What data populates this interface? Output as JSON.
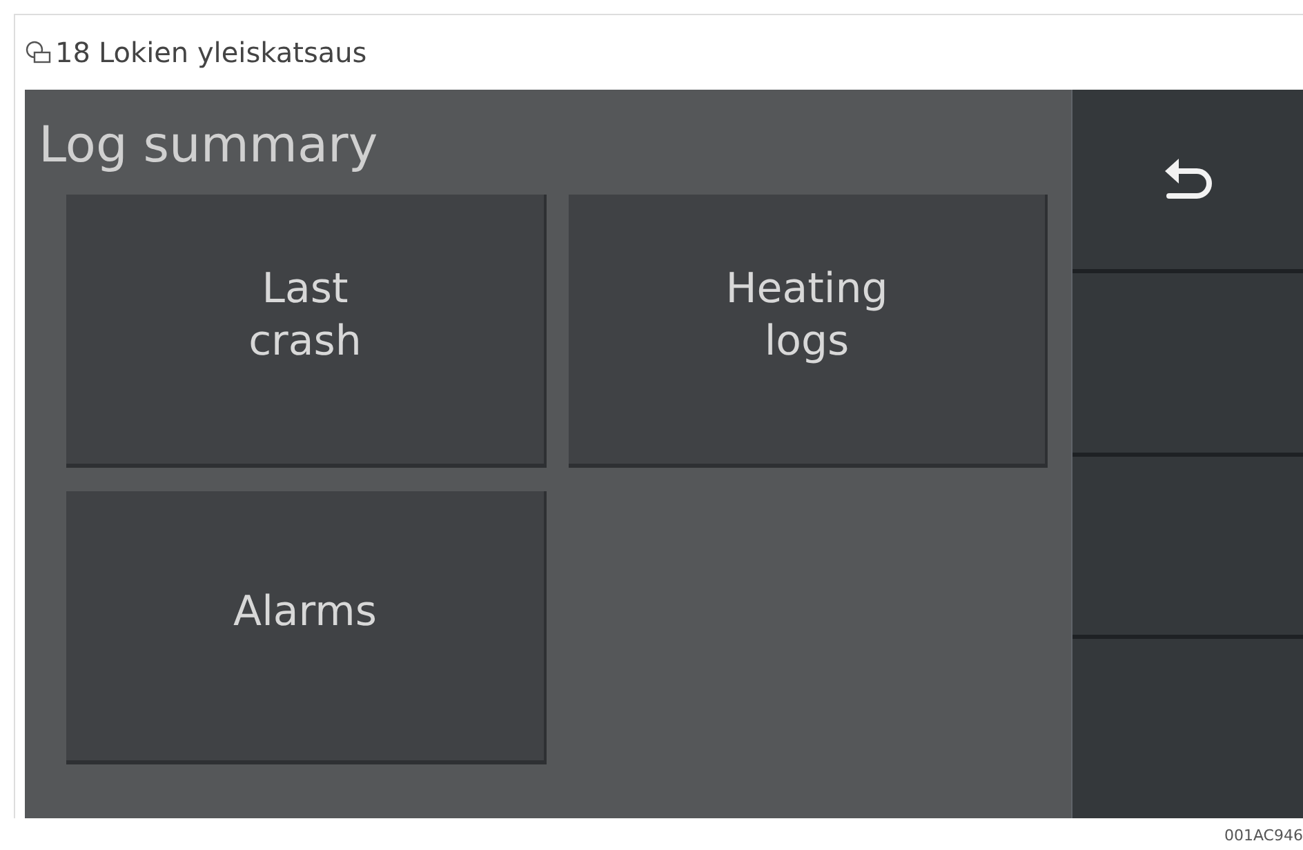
{
  "figure": {
    "number": "18",
    "caption": "Lokien yleiskatsaus"
  },
  "screen": {
    "title": "Log summary",
    "tiles": [
      {
        "label": "Last\ncrash"
      },
      {
        "label": "Heating\nlogs"
      },
      {
        "label": "Alarms"
      }
    ],
    "side_buttons": [
      {
        "kind": "back"
      },
      {
        "kind": "empty"
      },
      {
        "kind": "empty"
      },
      {
        "kind": "empty"
      }
    ]
  },
  "figure_code": "001AC946"
}
